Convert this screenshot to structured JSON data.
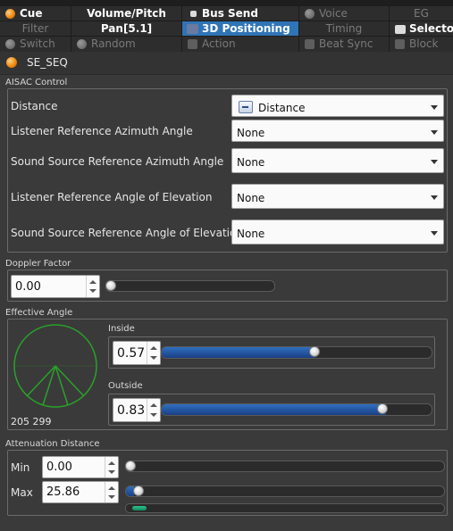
{
  "tabs": [
    {
      "label": "Cue",
      "row": 0,
      "state": "on",
      "icon": "orange-ball-icon"
    },
    {
      "label": "Volume/Pitch",
      "row": 0,
      "state": "on",
      "icon": ""
    },
    {
      "label": "Bus Send",
      "row": 0,
      "state": "on",
      "icon": "bus-send-icon"
    },
    {
      "label": "Voice",
      "row": 0,
      "state": "off",
      "icon": "grey-ball-icon"
    },
    {
      "label": "EG",
      "row": 0,
      "state": "off",
      "icon": ""
    },
    {
      "label": "Filter",
      "row": 1,
      "state": "off",
      "icon": ""
    },
    {
      "label": "Pan[5.1]",
      "row": 1,
      "state": "on",
      "icon": ""
    },
    {
      "label": "3D Positioning",
      "row": 1,
      "state": "selected",
      "icon": "3d-icon"
    },
    {
      "label": "Timing",
      "row": 1,
      "state": "off",
      "icon": ""
    },
    {
      "label": "Selector",
      "row": 1,
      "state": "on",
      "icon": "selector-icon"
    },
    {
      "label": "Switch",
      "row": 2,
      "state": "off",
      "icon": "switch-icon"
    },
    {
      "label": "Random",
      "row": 2,
      "state": "off",
      "icon": "random-icon"
    },
    {
      "label": "Action",
      "row": 2,
      "state": "off",
      "icon": "action-icon"
    },
    {
      "label": "Beat Sync",
      "row": 2,
      "state": "off",
      "icon": "beat-sync-icon"
    },
    {
      "label": "Block",
      "row": 2,
      "state": "off",
      "icon": "block-icon"
    }
  ],
  "header": {
    "title": "SE_SEQ"
  },
  "aisac": {
    "section_label": "AISAC Control",
    "rows": [
      {
        "label": "Distance",
        "value": "Distance",
        "has_icon": true
      },
      {
        "label": "Listener Reference Azimuth Angle",
        "value": "None"
      },
      {
        "label": "Sound Source Reference Azimuth Angle",
        "value": "None"
      },
      {
        "label": "Listener Reference Angle of Elevation",
        "value": "None"
      },
      {
        "label": "Sound Source Reference Angle of Elevation",
        "value": "None"
      }
    ]
  },
  "doppler": {
    "section_label": "Doppler Factor",
    "value": "0.00",
    "slider_fraction": 0.0
  },
  "effective_angle": {
    "section_label": "Effective Angle",
    "inside_label": "Inside",
    "inside_value": "0.57",
    "inside_fraction": 0.57,
    "outside_label": "Outside",
    "outside_value": "0.83",
    "outside_fraction": 0.83,
    "angles_text": "205 299",
    "cone_color": "#2aa12a"
  },
  "attenuation": {
    "section_label": "Attenuation Distance",
    "min_label": "Min",
    "min_value": "0.00",
    "min_fraction": 0.0,
    "max_label": "Max",
    "max_value": "25.86",
    "max_fraction": 0.026
  },
  "colors": {
    "selected_tab": "#2f74b6",
    "slider_fill": "#2f6fbf",
    "accent_green": "#1fa572"
  }
}
